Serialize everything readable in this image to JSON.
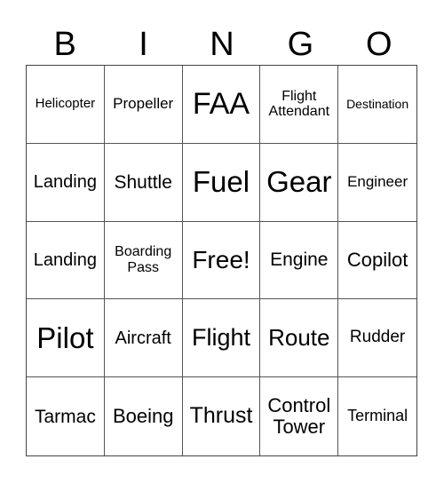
{
  "header": [
    "B",
    "I",
    "N",
    "G",
    "O"
  ],
  "cells": [
    {
      "text": "Helicopter",
      "size": 15
    },
    {
      "text": "Propeller",
      "size": 17
    },
    {
      "text": "FAA",
      "size": 34
    },
    {
      "text": "Flight Attendant",
      "size": 16
    },
    {
      "text": "Destination",
      "size": 14
    },
    {
      "text": "Landing",
      "size": 20
    },
    {
      "text": "Shuttle",
      "size": 21
    },
    {
      "text": "Fuel",
      "size": 33
    },
    {
      "text": "Gear",
      "size": 33
    },
    {
      "text": "Engineer",
      "size": 17
    },
    {
      "text": "Landing",
      "size": 20
    },
    {
      "text": "Boarding Pass",
      "size": 16
    },
    {
      "text": "Free!",
      "size": 28
    },
    {
      "text": "Engine",
      "size": 21
    },
    {
      "text": "Copilot",
      "size": 22
    },
    {
      "text": "Pilot",
      "size": 33
    },
    {
      "text": "Aircraft",
      "size": 20
    },
    {
      "text": "Flight",
      "size": 27
    },
    {
      "text": "Route",
      "size": 26
    },
    {
      "text": "Rudder",
      "size": 19
    },
    {
      "text": "Tarmac",
      "size": 21
    },
    {
      "text": "Boeing",
      "size": 22
    },
    {
      "text": "Thrust",
      "size": 25
    },
    {
      "text": "Control Tower",
      "size": 22
    },
    {
      "text": "Terminal",
      "size": 18
    }
  ]
}
